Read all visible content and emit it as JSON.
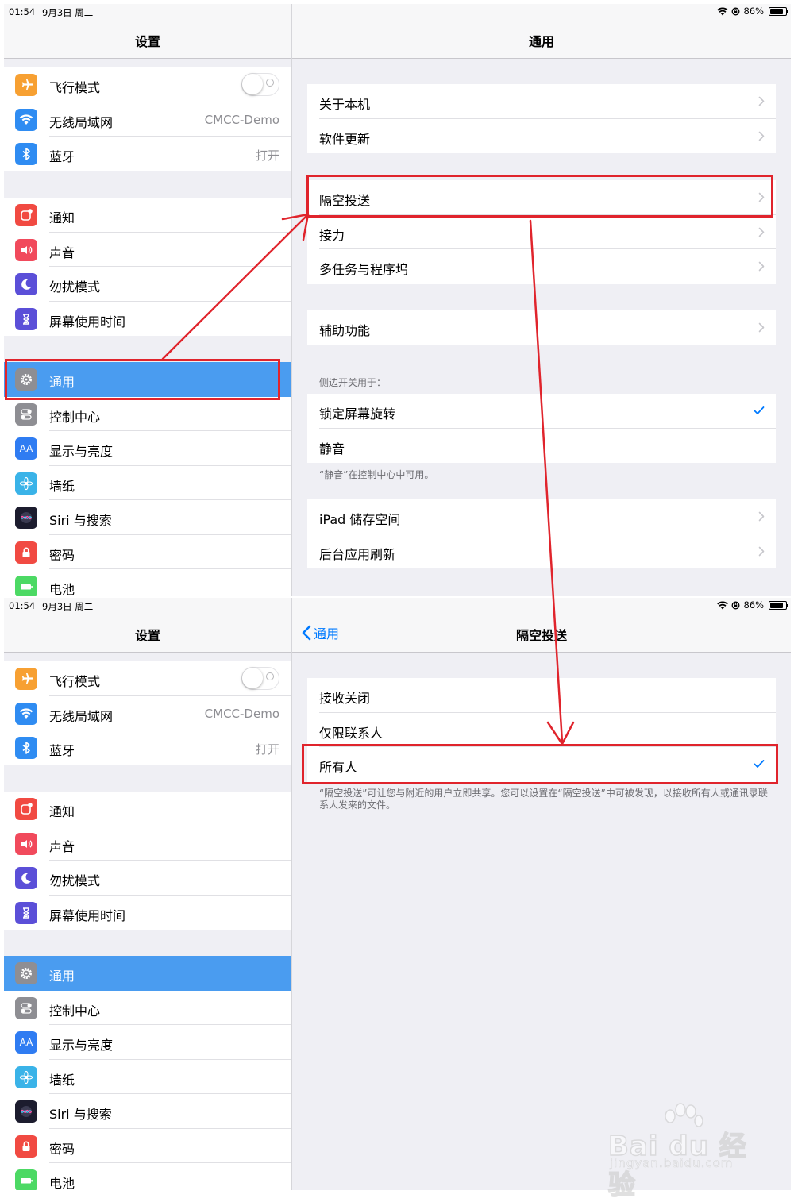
{
  "colors": {
    "accent": "#007aff",
    "selected": "#4a9cf0",
    "annotation": "#e0242c"
  },
  "status": {
    "time": "01:54",
    "date": "9月3日 周二",
    "battery": "86%"
  },
  "sidebar": {
    "title": "设置",
    "group1": [
      {
        "label": "飞行模式",
        "icon": "airplane-icon",
        "color": "#f7a032",
        "control": "toggle",
        "value": ""
      },
      {
        "label": "无线局域网",
        "icon": "wifi-icon",
        "color": "#2f8cf2",
        "value": "CMCC-Demo"
      },
      {
        "label": "蓝牙",
        "icon": "bluetooth-icon",
        "color": "#2f8cf2",
        "value": "打开"
      }
    ],
    "group2": [
      {
        "label": "通知",
        "icon": "notification-icon",
        "color": "#f14a42"
      },
      {
        "label": "声音",
        "icon": "sound-icon",
        "color": "#f14a5c"
      },
      {
        "label": "勿扰模式",
        "icon": "moon-icon",
        "color": "#5b4fd8"
      },
      {
        "label": "屏幕使用时间",
        "icon": "hourglass-icon",
        "color": "#5b4fd8"
      }
    ],
    "group3": [
      {
        "label": "通用",
        "icon": "gear-icon",
        "color": "#8e8e93",
        "selected": true
      },
      {
        "label": "控制中心",
        "icon": "switches-icon",
        "color": "#8e8e93"
      },
      {
        "label": "显示与亮度",
        "icon": "text-size-icon",
        "color": "#2f7cf2",
        "iconText": "AA"
      },
      {
        "label": "墙纸",
        "icon": "flower-icon",
        "color": "#3ab3e8"
      },
      {
        "label": "Siri 与搜索",
        "icon": "siri-icon",
        "color": "#1c1c2e"
      },
      {
        "label": "密码",
        "icon": "lock-icon",
        "color": "#f14a42"
      },
      {
        "label": "电池",
        "icon": "battery-icon",
        "color": "#4cd964"
      }
    ]
  },
  "general": {
    "title": "通用",
    "group1": [
      "关于本机",
      "软件更新"
    ],
    "group2": [
      "隔空投送",
      "接力",
      "多任务与程序坞"
    ],
    "group3": [
      "辅助功能"
    ],
    "side_switch_header": "侧边开关用于：",
    "group4": [
      "锁定屏幕旋转",
      "静音"
    ],
    "side_switch_footer": "“静音”在控制中心中可用。",
    "group5": [
      "iPad 储存空间",
      "后台应用刷新"
    ]
  },
  "airdrop": {
    "back_label": "通用",
    "title": "隔空投送",
    "options": [
      "接收关闭",
      "仅限联系人",
      "所有人"
    ],
    "selected": "所有人",
    "footer": "“隔空投送”可让您与附近的用户立即共享。您可以设置在“隔空投送”中可被发现，以接收所有人或通讯录联系人发来的文件。"
  },
  "watermark": {
    "brand": "Bai du 经验",
    "url": "jingyan.baidu.com"
  }
}
